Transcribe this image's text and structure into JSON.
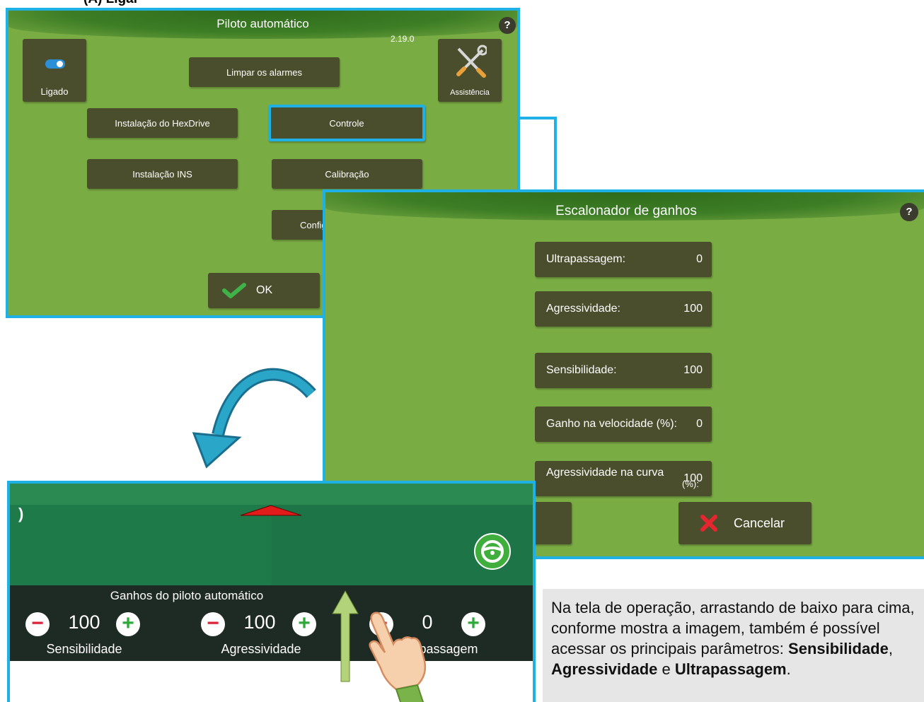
{
  "caption_top": "(A) Ligar",
  "panel1": {
    "title": "Piloto automático",
    "help": "?",
    "version": "2.19.0",
    "toggle_label": "Ligado",
    "assist_label": "Assistência",
    "buttons": {
      "clear_alarms": "Limpar os alarmes",
      "hexdrive": "Instalação do HexDrive",
      "control": "Controle",
      "ins": "Instalação INS",
      "calibration": "Calibração",
      "config": "Config",
      "ok": "OK"
    }
  },
  "panel2": {
    "title": "Escalonador de ganhos",
    "help": "?",
    "fields": [
      {
        "label": "Ultrapassagem:",
        "value": "0"
      },
      {
        "label": "Agressividade:",
        "value": "100"
      },
      {
        "label": "Sensibilidade:",
        "value": "100"
      },
      {
        "label": "Ganho na velocidade (%):",
        "value": "0"
      },
      {
        "label": "Agressividade na curva",
        "label2": "(%):",
        "value": "100"
      }
    ],
    "cancel_label": "Cancelar"
  },
  "panel3": {
    "bar_title": "Ganhos do piloto automático",
    "gains": [
      {
        "value": "100",
        "label": "Sensibilidade"
      },
      {
        "value": "100",
        "label": "Agressividade"
      },
      {
        "value": "0",
        "label": "Ultrapassagem",
        "visible_label": "passagem"
      }
    ]
  },
  "note": {
    "text": "Na tela de operação, arrastando de baixo para cima, conforme mostra a imagem, também é possível acessar os principais parâmetros: ",
    "b1": "Sensibilidade",
    "sep1": ",",
    "b2": "Agressividade",
    "sep2": " e ",
    "b3": "Ultrapassagem",
    "end": "."
  },
  "colors": {
    "panel_green": "#7aac44",
    "button_dark": "#4a4e2c",
    "highlight_blue": "#1fb1e6",
    "field_green": "#1f7a4a",
    "minus_red": "#d9263a",
    "plus_green": "#2eaa3a"
  }
}
